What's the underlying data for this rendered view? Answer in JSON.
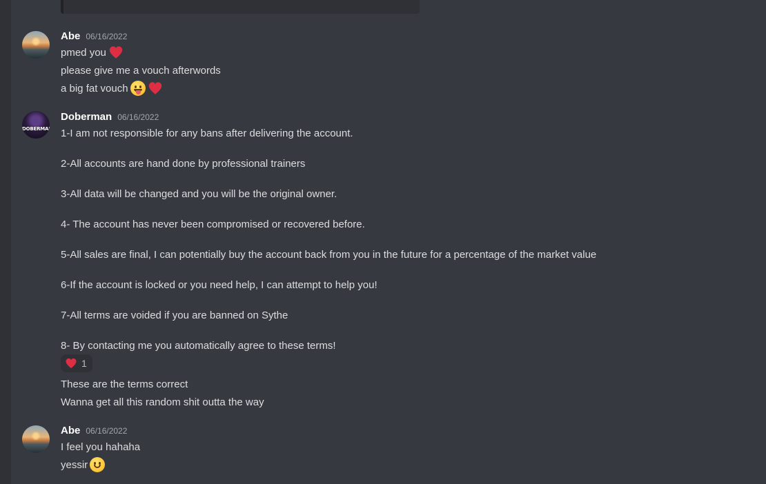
{
  "messages": [
    {
      "author": "Abe",
      "timestamp": "06/16/2022",
      "lines": [
        "pmed you",
        "please give me a vouch afterwords",
        "a big fat vouch"
      ]
    },
    {
      "author": "Doberman",
      "timestamp": "06/16/2022",
      "avatar_text": "DOBERMAN",
      "lines": [
        "1-I am not responsible for any bans after delivering the account.",
        "2-All accounts are hand done by professional trainers",
        "3-All data will be changed and you will be the original owner.",
        "4- The account has never been compromised or recovered before.",
        "5-All sales are final, I can potentially buy the account back from you in the future for a percentage of the market value",
        "6-If the account is locked or you need help, I can attempt to help you!",
        "7-All terms are voided if you are banned on Sythe",
        "8- By contacting me you automatically agree to these terms!"
      ],
      "reaction": {
        "emoji": "heart-icon",
        "count": "1"
      },
      "followup": [
        "These are the terms correct",
        "Wanna get all this random shit outta the way"
      ]
    },
    {
      "author": "Abe",
      "timestamp": "06/16/2022",
      "lines": [
        "I feel you hahaha",
        "yessir"
      ]
    }
  ],
  "colors": {
    "background": "#36393f",
    "username": "#ffffff",
    "text": "#dcddde",
    "timestamp": "#a3a6aa",
    "heart": "#dd2e44"
  }
}
